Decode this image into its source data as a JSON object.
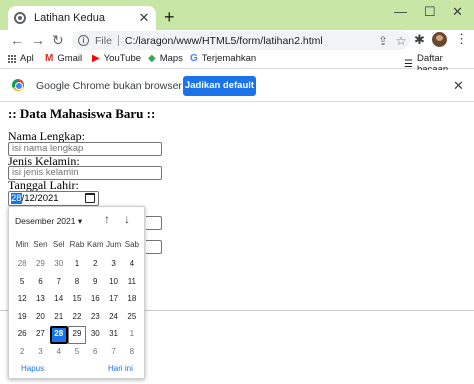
{
  "browser": {
    "tab_title": "Latihan Kedua",
    "tab_close": "✕",
    "new_tab": "+",
    "window_controls": {
      "minimize": "—",
      "maximize": "☐",
      "close": "✕"
    },
    "nav": {
      "back": "←",
      "forward": "→",
      "reload": "↻"
    },
    "omnibox": {
      "security": "File",
      "url": "C:/laragon/www/HTML5/form/latihan2.html"
    },
    "toolbar_icons": [
      "share-icon",
      "star-icon",
      "extensions-icon",
      "profile-avatar",
      "menu-icon"
    ],
    "bookmarks": [
      {
        "label": "Apl",
        "icon": "apps-grid-icon"
      },
      {
        "label": "Gmail",
        "icon": "gmail-icon"
      },
      {
        "label": "YouTube",
        "icon": "youtube-icon"
      },
      {
        "label": "Maps",
        "icon": "maps-icon"
      },
      {
        "label": "Terjemahkan",
        "icon": "translate-icon"
      }
    ],
    "reading_list": "Daftar bacaan",
    "infobar": {
      "text": "Google Chrome bukan browser default",
      "button": "Jadikan default",
      "close": "✕"
    },
    "accent": "#1a73e8",
    "titlebar_color": "#c8e6a5"
  },
  "form": {
    "heading": ":: Data Mahasiswa Baru ::",
    "name_label": "Nama Lengkap:",
    "name_placeholder": "isi nama lengkap",
    "gender_label": "Jenis Kelamin:",
    "gender_placeholder": "isi jenis kelamin",
    "date_label": "Tanggal Lahir:",
    "date_value": {
      "day": "28",
      "rest": "/12/2021"
    }
  },
  "datepicker": {
    "month_label": "Desember 2021 ▾",
    "prev": "↑",
    "next": "↓",
    "weekdays": [
      "Min",
      "Sen",
      "Sel",
      "Rab",
      "Kam",
      "Jum",
      "Sab"
    ],
    "weeks": [
      [
        "28",
        "29",
        "30",
        "1",
        "2",
        "3",
        "4"
      ],
      [
        "5",
        "6",
        "7",
        "8",
        "9",
        "10",
        "11"
      ],
      [
        "12",
        "13",
        "14",
        "15",
        "16",
        "17",
        "18"
      ],
      [
        "19",
        "20",
        "21",
        "22",
        "23",
        "24",
        "25"
      ],
      [
        "26",
        "27",
        "28",
        "29",
        "30",
        "31",
        "1"
      ],
      [
        "2",
        "3",
        "4",
        "5",
        "6",
        "7",
        "8"
      ]
    ],
    "selected": "28",
    "clear": "Hapus",
    "today": "Hari ini"
  }
}
